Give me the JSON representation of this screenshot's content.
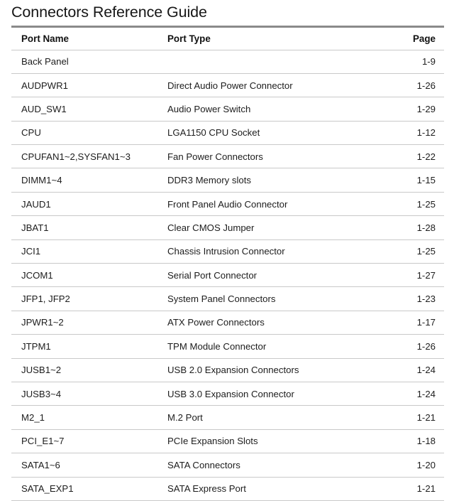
{
  "document": {
    "title": "Connectors Reference Guide",
    "accent_rule_color": "#8a8a8a",
    "divider_color": "#c9c9c9",
    "text_color": "#1d1d1d",
    "background_color": "#ffffff"
  },
  "table": {
    "columns": [
      {
        "key": "port_name",
        "label": "Port Name",
        "align": "left"
      },
      {
        "key": "port_type",
        "label": "Port Type",
        "align": "left"
      },
      {
        "key": "page",
        "label": "Page",
        "align": "right"
      }
    ],
    "rows": [
      {
        "port_name": "Back Panel",
        "port_type": "",
        "page": "1-9"
      },
      {
        "port_name": "AUDPWR1",
        "port_type": "Direct Audio Power Connector",
        "page": "1-26"
      },
      {
        "port_name": "AUD_SW1",
        "port_type": "Audio Power Switch",
        "page": "1-29"
      },
      {
        "port_name": "CPU",
        "port_type": "LGA1150 CPU Socket",
        "page": "1-12"
      },
      {
        "port_name": "CPUFAN1~2,SYSFAN1~3",
        "port_type": "Fan Power Connectors",
        "page": "1-22"
      },
      {
        "port_name": "DIMM1~4",
        "port_type": "DDR3 Memory slots",
        "page": "1-15"
      },
      {
        "port_name": "JAUD1",
        "port_type": "Front Panel Audio Connector",
        "page": "1-25"
      },
      {
        "port_name": "JBAT1",
        "port_type": "Clear CMOS Jumper",
        "page": "1-28"
      },
      {
        "port_name": "JCI1",
        "port_type": "Chassis Intrusion Connector",
        "page": "1-25"
      },
      {
        "port_name": "JCOM1",
        "port_type": "Serial Port Connector",
        "page": "1-27"
      },
      {
        "port_name": "JFP1, JFP2",
        "port_type": "System Panel Connectors",
        "page": "1-23"
      },
      {
        "port_name": "JPWR1~2",
        "port_type": "ATX Power Connectors",
        "page": "1-17"
      },
      {
        "port_name": "JTPM1",
        "port_type": "TPM Module Connector",
        "page": "1-26"
      },
      {
        "port_name": "JUSB1~2",
        "port_type": "USB 2.0 Expansion Connectors",
        "page": "1-24"
      },
      {
        "port_name": "JUSB3~4",
        "port_type": "USB 3.0 Expansion Connector",
        "page": "1-24"
      },
      {
        "port_name": "M2_1",
        "port_type": "M.2 Port",
        "page": "1-21"
      },
      {
        "port_name": "PCI_E1~7",
        "port_type": "PCIe Expansion Slots",
        "page": "1-18"
      },
      {
        "port_name": "SATA1~6",
        "port_type": "SATA Connectors",
        "page": "1-20"
      },
      {
        "port_name": "SATA_EXP1",
        "port_type": "SATA Express Port",
        "page": "1-21"
      }
    ]
  }
}
